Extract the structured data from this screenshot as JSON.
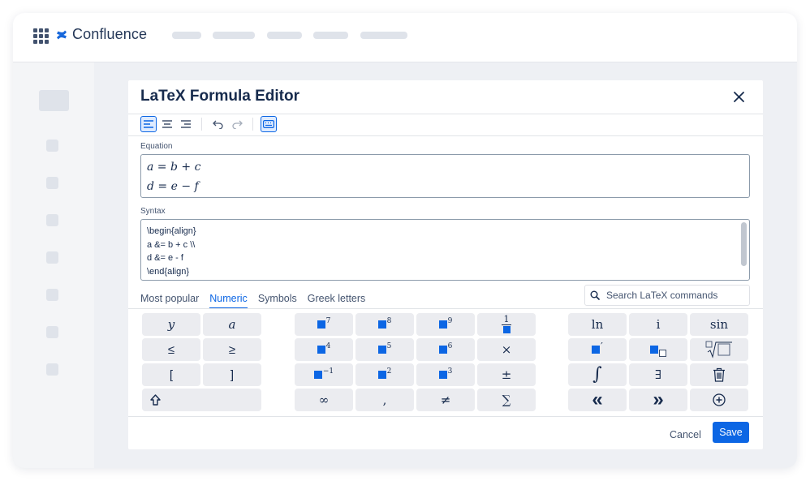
{
  "app": {
    "name": "Confluence"
  },
  "modal": {
    "title": "LaTeX Formula Editor",
    "equation_label": "Equation",
    "equation_lines": [
      "a = b + c",
      "d = e − f"
    ],
    "syntax_label": "Syntax",
    "syntax_lines": [
      "\\begin{align}",
      "a &= b + c \\\\",
      "d &= e - f",
      "\\end{align}"
    ],
    "tabs": [
      "Most popular",
      "Numeric",
      "Symbols",
      "Greek letters"
    ],
    "active_tab": "Numeric",
    "search_placeholder": "Search LaTeX commands",
    "cancel_label": "Cancel",
    "save_label": "Save"
  },
  "keys": {
    "y": "y",
    "a": "a",
    "le": "≤",
    "ge": "≥",
    "lbracket": "[",
    "rbracket": "]",
    "pow7": "7",
    "pow8": "8",
    "pow9": "9",
    "frac_num": "1",
    "pow4": "4",
    "pow5": "5",
    "pow6": "6",
    "times": "×",
    "pow_neg1": "−1",
    "pow2": "2",
    "pow3": "3",
    "pm": "±",
    "infinity": "∞",
    "comma": ",",
    "neq": "≠",
    "sum": "∑",
    "ln": "ln",
    "i": "i",
    "sin": "sin",
    "prime": "′",
    "integral": "∫",
    "exists": "∃",
    "left_guillemet": "«",
    "right_guillemet": "»"
  },
  "colors": {
    "accent": "#0c66e4",
    "key_bg": "#ebecf0",
    "text": "#172b4d"
  }
}
